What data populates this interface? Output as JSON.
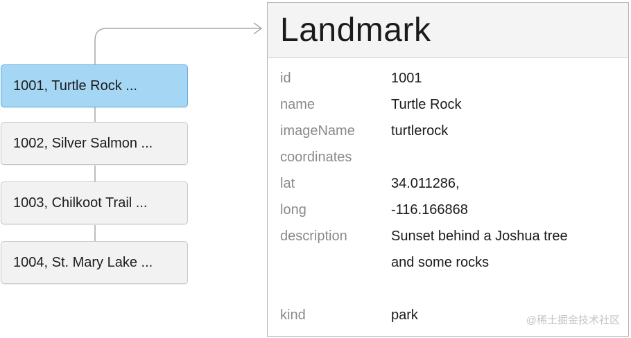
{
  "list": {
    "items": [
      {
        "label": "1001, Turtle Rock ..."
      },
      {
        "label": "1002, Silver Salmon ..."
      },
      {
        "label": "1003, Chilkoot Trail ..."
      },
      {
        "label": "1004, St. Mary Lake ..."
      }
    ],
    "selected_index": 0
  },
  "detail": {
    "title": "Landmark",
    "fields": [
      {
        "key": "id",
        "value": "1001"
      },
      {
        "key": "name",
        "value": "Turtle Rock"
      },
      {
        "key": "imageName",
        "value": "turtlerock"
      },
      {
        "key": "coordinates",
        "value": ""
      },
      {
        "key": "lat",
        "value": "34.011286,"
      },
      {
        "key": "long",
        "value": "-116.166868"
      },
      {
        "key": "description",
        "value": "Sunset behind a Joshua tree"
      },
      {
        "key": "",
        "value": "and some rocks"
      },
      {
        "key": "kind",
        "value": "park"
      }
    ]
  },
  "watermark": "@稀土掘金技术社区",
  "colors": {
    "selected_fill": "#a5d6f4",
    "selected_border": "#68aee0",
    "card_fill": "#f2f2f2",
    "connector": "#a8a8a8"
  }
}
